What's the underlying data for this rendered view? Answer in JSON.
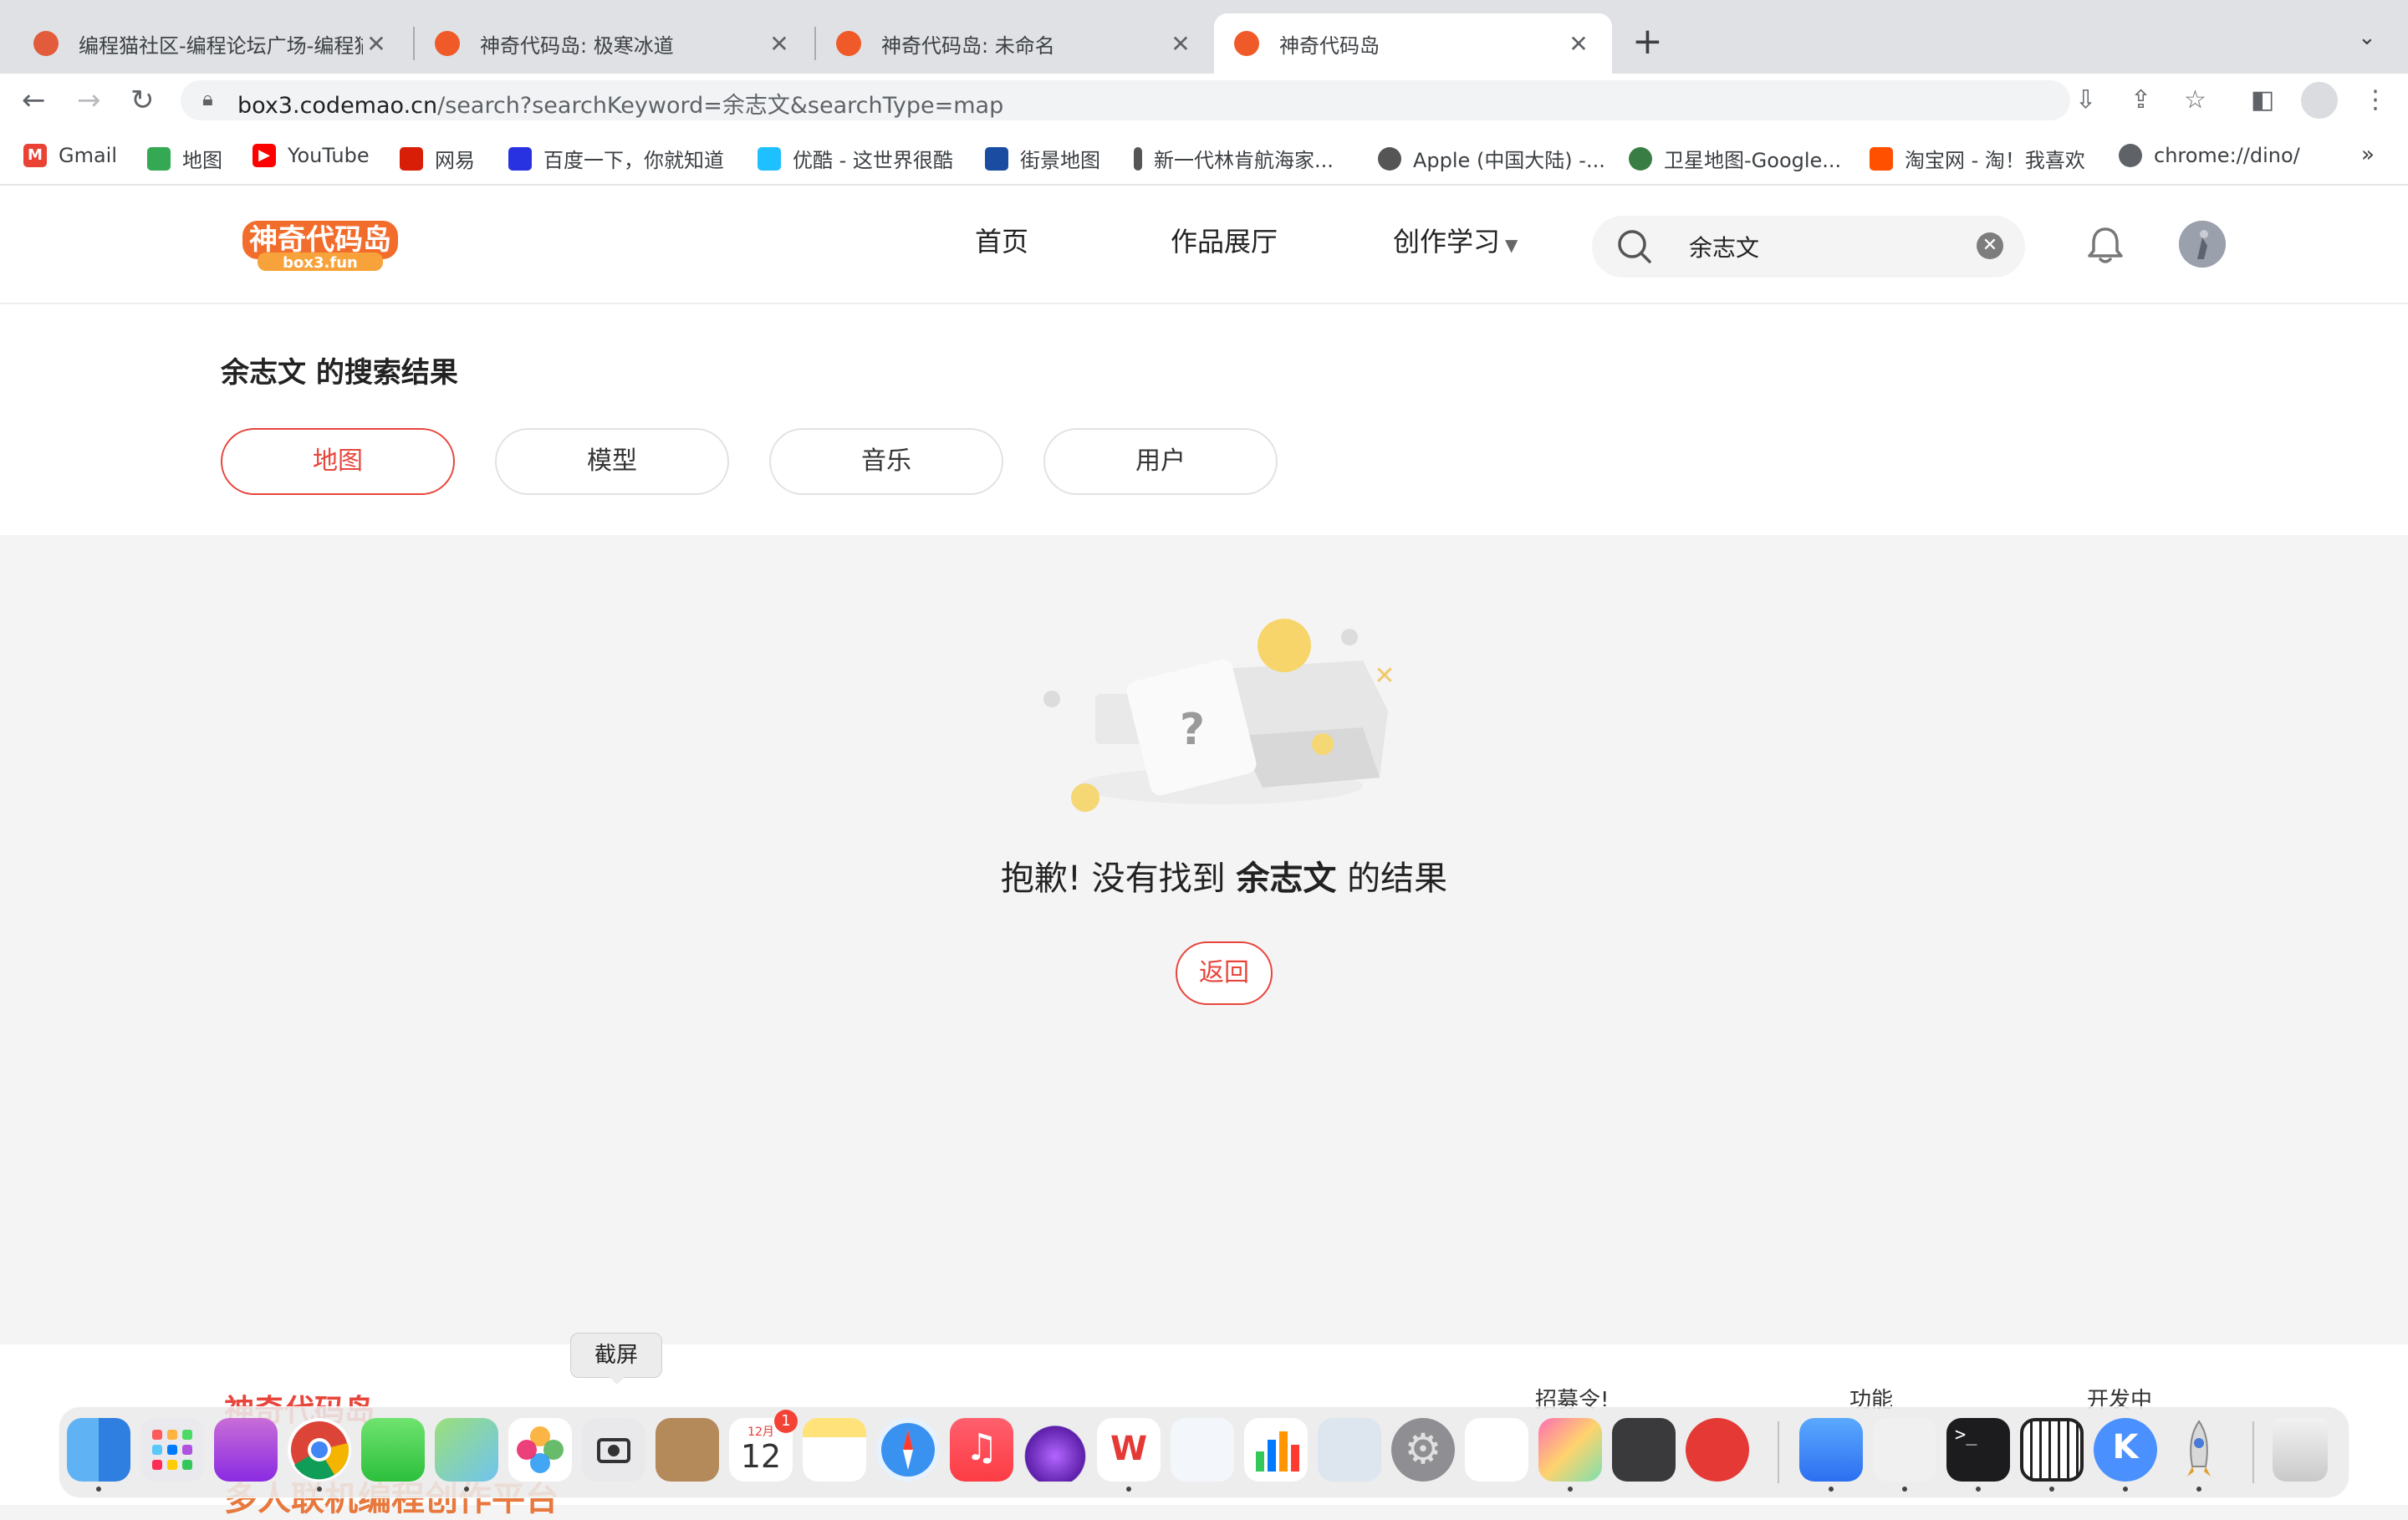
{
  "browser": {
    "tabs": [
      {
        "title": "编程猫社区-编程论坛广场-编程猫",
        "active": false
      },
      {
        "title": "神奇代码岛: 极寒冰道",
        "active": false
      },
      {
        "title": "神奇代码岛: 未命名",
        "active": false
      },
      {
        "title": "神奇代码岛",
        "active": true
      }
    ],
    "new_tab": "+",
    "url_host": "box3.codemao.cn",
    "url_rest": "/search?searchKeyword=余志文&searchType=map",
    "bookmarks": [
      {
        "label": "Gmail",
        "icon": "gmail-icon",
        "color": "#ea4335"
      },
      {
        "label": "地图",
        "icon": "maps-icon",
        "color": "#34a853"
      },
      {
        "label": "YouTube",
        "icon": "youtube-icon",
        "color": "#ff0000"
      },
      {
        "label": "网易",
        "icon": "netease-icon",
        "color": "#d81e06"
      },
      {
        "label": "百度一下，你就知道",
        "icon": "baidu-icon",
        "color": "#2932e1"
      },
      {
        "label": "优酷 - 这世界很酷",
        "icon": "youku-icon",
        "color": "#1ec0ff"
      },
      {
        "label": "街景地图",
        "icon": "streetview-icon",
        "color": "#1a4da2"
      },
      {
        "label": "新一代林肯航海家...",
        "icon": "lincoln-icon",
        "color": "#555555"
      },
      {
        "label": "Apple (中国大陆) -...",
        "icon": "apple-icon",
        "color": "#555555"
      },
      {
        "label": "卫星地图-Google...",
        "icon": "globe-icon",
        "color": "#3a7d44"
      },
      {
        "label": "淘宝网 - 淘！我喜欢",
        "icon": "taobao-icon",
        "color": "#ff5000"
      },
      {
        "label": "chrome://dino/",
        "icon": "chrome-page-icon",
        "color": "#5f6368"
      }
    ],
    "bookmarks_more": "»"
  },
  "site": {
    "logo_text": "神奇代码岛",
    "logo_sub": "box3.fun",
    "nav": [
      "首页",
      "作品展厅",
      "创作学习"
    ],
    "search_value": "余志文"
  },
  "results": {
    "keyword": "余志文",
    "title_suffix": " 的搜索结果",
    "filters": [
      {
        "label": "地图",
        "active": true
      },
      {
        "label": "模型",
        "active": false
      },
      {
        "label": "音乐",
        "active": false
      },
      {
        "label": "用户",
        "active": false
      }
    ],
    "empty_prefix": "抱歉! 没有找到 ",
    "empty_suffix": " 的结果",
    "back_label": "返回"
  },
  "footer": {
    "logo": "神奇代码岛",
    "headings": [
      "招募令!",
      "功能",
      "开发中"
    ],
    "slogan": "多人联机编程创作平台"
  },
  "dock": {
    "tooltip": "截屏",
    "calendar_month": "12月",
    "calendar_day": "12",
    "calendar_badge": "1",
    "apps": [
      "finder",
      "launchpad",
      "podcasts",
      "chrome",
      "messages",
      "maps",
      "photos",
      "screenshot",
      "contacts",
      "calendar",
      "notes",
      "safari",
      "music",
      "creator",
      "wps",
      "keynote",
      "numbers",
      "preview",
      "system-preferences",
      "pages",
      "color-ui",
      "calculator",
      "instruments",
      "feishu",
      "script-editor",
      "terminal",
      "piano",
      "k-app",
      "rocket",
      "trash"
    ]
  },
  "colors": {
    "accent": "#e8453c",
    "page_bg": "#f4f4f4"
  }
}
